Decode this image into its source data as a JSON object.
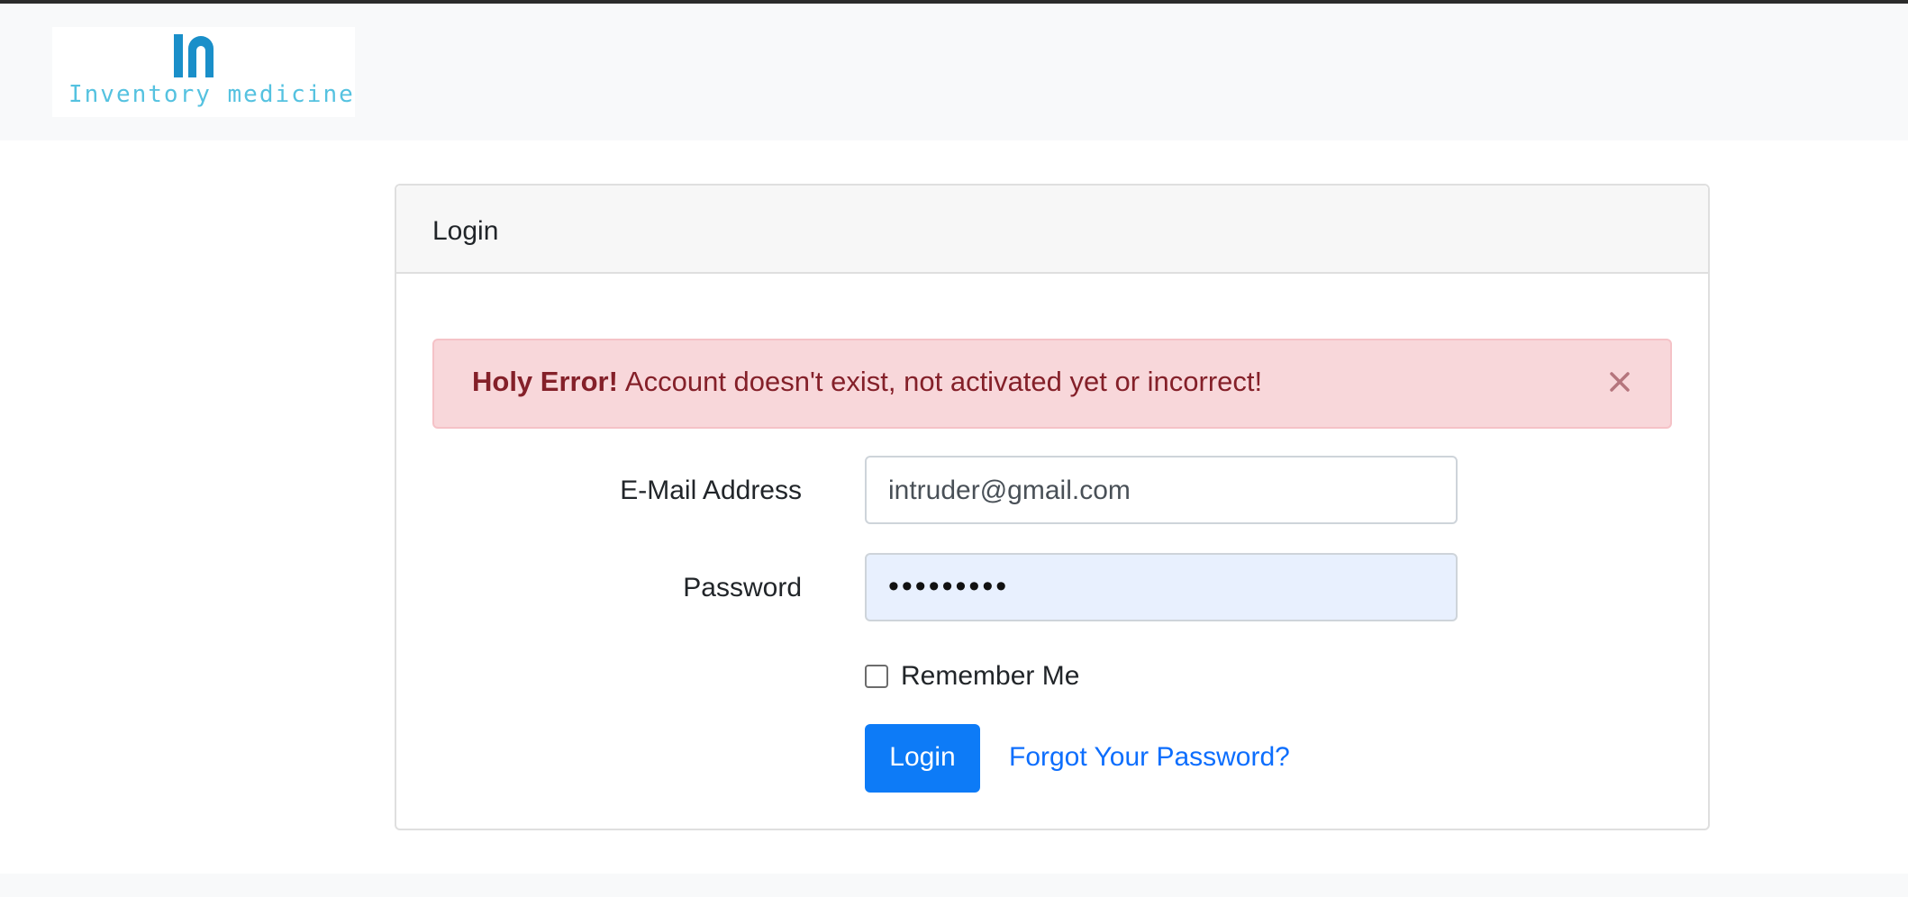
{
  "header": {
    "logo_text": "Inventory medicine",
    "logo_alt": "Inventory medicine logo"
  },
  "card": {
    "title": "Login"
  },
  "alert": {
    "strong": "Holy Error!",
    "message": "Account doesn't exist, not activated yet or incorrect!",
    "close_icon": "close-icon",
    "colors": {
      "background": "#f8d7da",
      "text": "#842029"
    }
  },
  "form": {
    "email_label": "E-Mail Address",
    "email_value": "intruder@gmail.com",
    "password_label": "Password",
    "password_value": "•••••••••",
    "remember_label": "Remember Me",
    "remember_checked": false,
    "login_button": "Login",
    "forgot_link": "Forgot Your Password?"
  },
  "colors": {
    "primary": "#0d7bf7",
    "link": "#0d6efd",
    "navbar_bg": "#f8f9fa"
  }
}
